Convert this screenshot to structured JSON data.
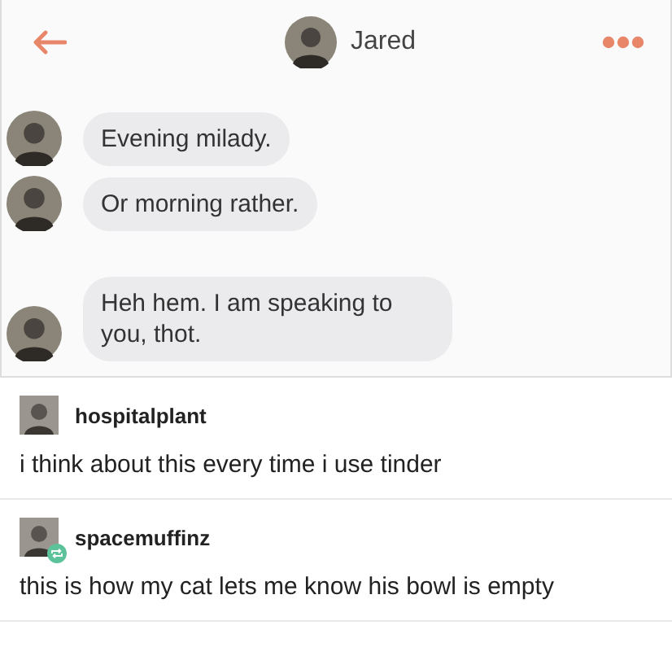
{
  "chat": {
    "contact_name": "Jared",
    "messages": [
      {
        "text": "Evening milady."
      },
      {
        "text": "Or morning rather."
      },
      {
        "text": "Heh hem.  I am speaking to you,  thot."
      }
    ]
  },
  "posts": [
    {
      "username": "hospitalplant",
      "reblogged": false,
      "text": "i think about this every time i use tinder"
    },
    {
      "username": "spacemuffinz",
      "reblogged": true,
      "text": "this is how my cat lets me know his bowl is empty"
    }
  ]
}
